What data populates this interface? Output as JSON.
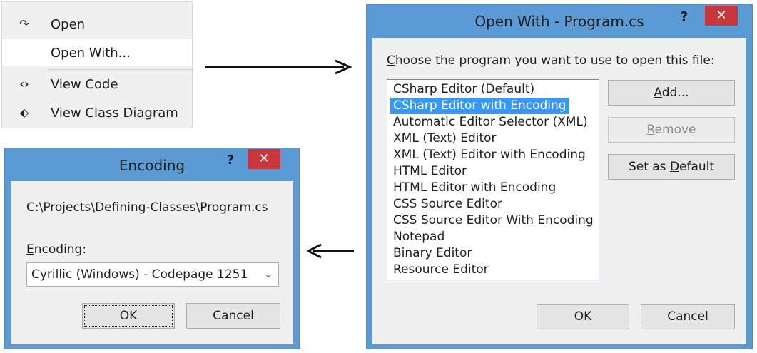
{
  "context_menu": {
    "items": [
      {
        "icon": "redo-arrow-icon",
        "glyph": "↷",
        "label": "Open"
      },
      {
        "icon": "",
        "glyph": "",
        "label": "Open With..."
      },
      {
        "icon": "code-brackets-icon",
        "glyph": "‹›",
        "label": "View Code"
      },
      {
        "icon": "class-diagram-icon",
        "glyph": "⬖",
        "label": "View Class Diagram"
      }
    ]
  },
  "open_with": {
    "title": "Open With - Program.cs",
    "help": "?",
    "close": "✕",
    "prompt_prefix": "C",
    "prompt_rest": "hoose the program you want to use to open this file:",
    "programs": [
      "CSharp Editor (Default)",
      "CSharp Editor with Encoding",
      "Automatic Editor Selector (XML)",
      "XML (Text) Editor",
      "XML (Text) Editor with Encoding",
      "HTML Editor",
      "HTML Editor with Encoding",
      "CSS Source Editor",
      "CSS Source Editor With Encoding",
      "Notepad",
      "Binary Editor",
      "Resource Editor"
    ],
    "selected_index": 1,
    "add_prefix": "A",
    "add_rest": "dd...",
    "remove_prefix": "R",
    "remove_rest": "emove",
    "set_default_pre": "Set as ",
    "set_default_u": "D",
    "set_default_post": "efault",
    "ok": "OK",
    "cancel": "Cancel"
  },
  "encoding": {
    "title": "Encoding",
    "help": "?",
    "close": "✕",
    "path": "C:\\Projects\\Defining-Classes\\Program.cs",
    "label_prefix": "E",
    "label_rest": "ncoding:",
    "selected": "Cyrillic (Windows) - Codepage 1251",
    "ok": "OK",
    "cancel": "Cancel"
  },
  "colors": {
    "window_frame": "#5b9bd5",
    "close_button": "#c8383a",
    "selection": "#3399ff"
  }
}
